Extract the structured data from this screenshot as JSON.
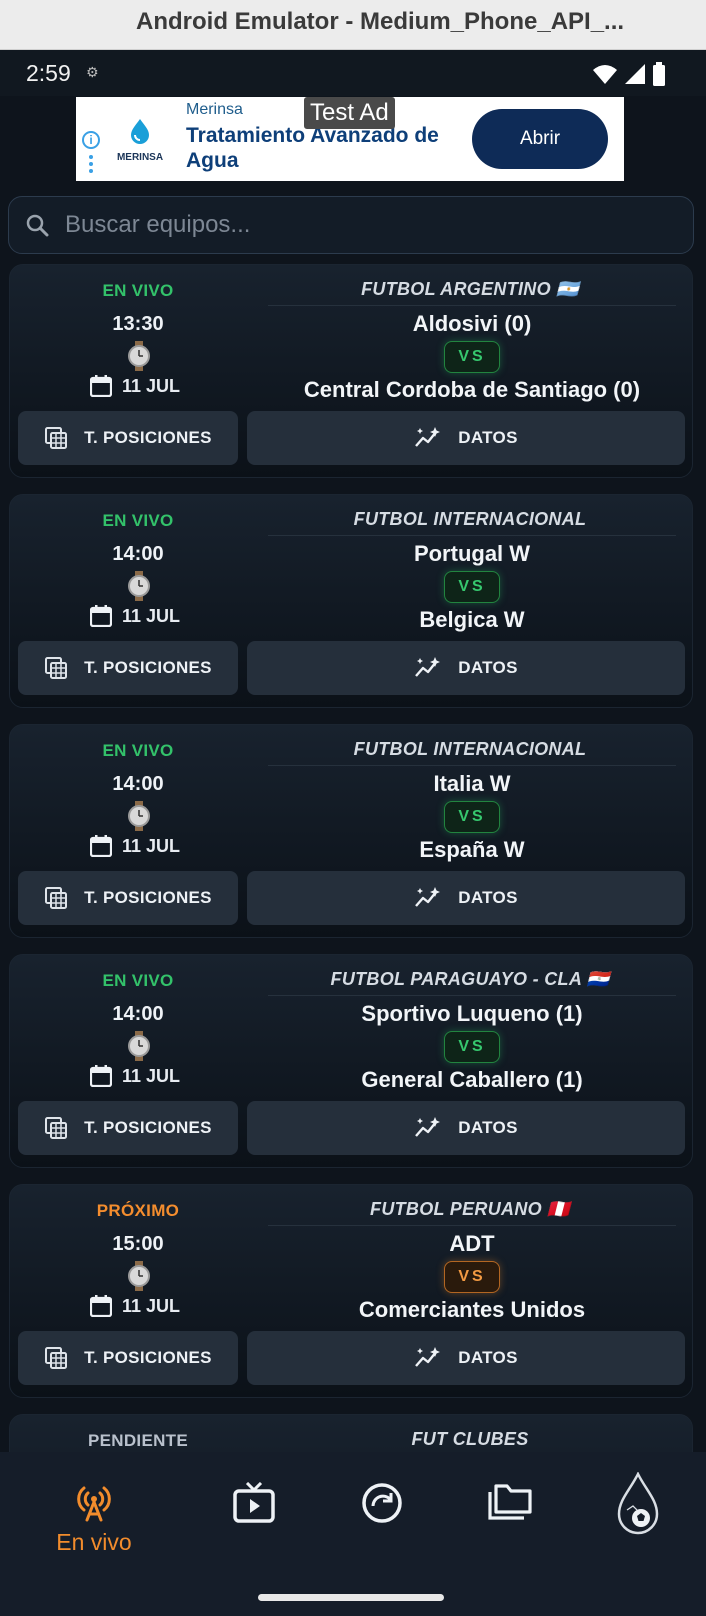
{
  "window": {
    "title": "Android Emulator - Medium_Phone_API_..."
  },
  "status_bar": {
    "time": "2:59"
  },
  "ad": {
    "label": "Test Ad",
    "sponsor": "Merinsa",
    "brand": "MERINSA",
    "headline": "Tratamiento Avanzado de Agua",
    "cta": "Abrir"
  },
  "search": {
    "placeholder": "Buscar equipos..."
  },
  "matches": [
    {
      "status": "EN VIVO",
      "status_type": "live",
      "time": "13:30",
      "date": "11 JUL",
      "league": "FUTBOL ARGENTINO 🇦🇷",
      "home": "Aldosivi (0)",
      "vs": "VS",
      "away": "Central Cordoba de Santiago (0)",
      "standings_label": "T. POSICIONES",
      "stats_label": "DATOS"
    },
    {
      "status": "EN VIVO",
      "status_type": "live",
      "time": "14:00",
      "date": "11 JUL",
      "league": "FUTBOL INTERNACIONAL",
      "home": "Portugal W",
      "vs": "VS",
      "away": "Belgica W",
      "standings_label": "T. POSICIONES",
      "stats_label": "DATOS"
    },
    {
      "status": "EN VIVO",
      "status_type": "live",
      "time": "14:00",
      "date": "11 JUL",
      "league": "FUTBOL INTERNACIONAL",
      "home": "Italia W",
      "vs": "VS",
      "away": "España W",
      "standings_label": "T. POSICIONES",
      "stats_label": "DATOS"
    },
    {
      "status": "EN VIVO",
      "status_type": "live",
      "time": "14:00",
      "date": "11 JUL",
      "league": "FUTBOL PARAGUAYO - CLA 🇵🇾",
      "home": "Sportivo Luqueno (1)",
      "vs": "VS",
      "away": "General Caballero (1)",
      "standings_label": "T. POSICIONES",
      "stats_label": "DATOS"
    },
    {
      "status": "PRÓXIMO",
      "status_type": "next",
      "time": "15:00",
      "date": "11 JUL",
      "league": "FUTBOL PERUANO 🇵🇪",
      "home": "ADT",
      "vs": "VS",
      "away": "Comerciantes Unidos",
      "standings_label": "T. POSICIONES",
      "stats_label": "DATOS"
    },
    {
      "status": "PENDIENTE",
      "status_type": "pend",
      "league": "FUT CLUBES"
    }
  ],
  "bottom_nav": {
    "items": [
      {
        "icon": "broadcast-icon",
        "label": "En vivo",
        "active": true
      },
      {
        "icon": "tv-icon"
      },
      {
        "icon": "refresh-circle-icon"
      },
      {
        "icon": "folder-icon"
      },
      {
        "icon": "soccer-drop-icon"
      }
    ]
  },
  "colors": {
    "live": "#33c26a",
    "next": "#f48d2e",
    "active_nav": "#f28c2c",
    "background": "#0e141c"
  }
}
